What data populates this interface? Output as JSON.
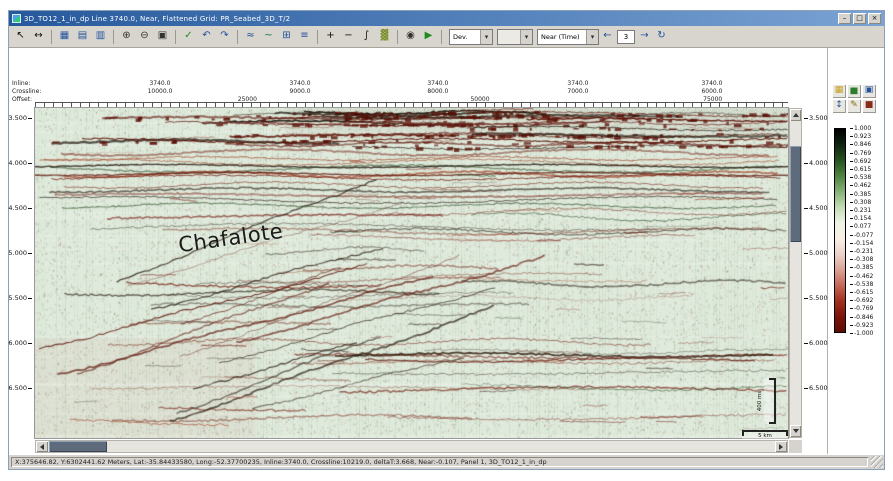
{
  "window": {
    "title": "3D_TO12_1_in_dp Line 3740.0, Near, Flattened Grid: PR_Seabed_3D_T/2",
    "buttons": [
      {
        "name": "minimize-button",
        "glyph": "–"
      },
      {
        "name": "maximize-button",
        "glyph": "□"
      },
      {
        "name": "close-button",
        "glyph": "×"
      }
    ]
  },
  "toolbar": {
    "icons": [
      {
        "name": "pointer-icon",
        "glyph": "↖",
        "color": "#111111"
      },
      {
        "name": "measure-icon",
        "glyph": "↔",
        "color": "#111111"
      },
      {
        "sep": true
      },
      {
        "name": "spreadsheet-icon",
        "glyph": "▦",
        "color": "#23519e"
      },
      {
        "name": "table-icon",
        "glyph": "▤",
        "color": "#23519e"
      },
      {
        "name": "histogram-icon",
        "glyph": "▥",
        "color": "#23519e"
      },
      {
        "sep": true
      },
      {
        "name": "zoom-in-icon",
        "glyph": "⊕",
        "color": "#333333"
      },
      {
        "name": "zoom-out-icon",
        "glyph": "⊖",
        "color": "#333333"
      },
      {
        "name": "zoom-window-icon",
        "glyph": "▣",
        "color": "#333333"
      },
      {
        "sep": true
      },
      {
        "name": "accept-icon",
        "glyph": "✓",
        "color": "#1f8a1f"
      },
      {
        "name": "undo-icon",
        "glyph": "↶",
        "color": "#23519e"
      },
      {
        "name": "redo-icon",
        "glyph": "↷",
        "color": "#23519e"
      },
      {
        "sep": true
      },
      {
        "name": "flatten-icon",
        "glyph": "≈",
        "color": "#23519e"
      },
      {
        "name": "horizon-icon",
        "glyph": "~",
        "color": "#0a7a3c"
      },
      {
        "name": "grid-icon",
        "glyph": "⊞",
        "color": "#23519e"
      },
      {
        "name": "layers-icon",
        "glyph": "≡",
        "color": "#23519e"
      },
      {
        "sep": true
      },
      {
        "name": "gain-up-icon",
        "glyph": "+",
        "color": "#111111"
      },
      {
        "name": "gain-down-icon",
        "glyph": "−",
        "color": "#111111"
      },
      {
        "name": "wiggle-trace-icon",
        "glyph": "∫",
        "color": "#111111"
      },
      {
        "name": "variable-density-icon",
        "glyph": "▓",
        "color": "#7a8f2a"
      },
      {
        "sep": true
      },
      {
        "name": "snapshot-icon",
        "glyph": "◉",
        "color": "#333333"
      },
      {
        "name": "play-icon",
        "glyph": "▶",
        "color": "#1f8a1f"
      },
      {
        "sep": true
      }
    ],
    "dev_dropdown_value": "Dev.",
    "disabled_dropdown_value": "",
    "mode_dropdown_value": "Near (Time)",
    "prev_icon": {
      "glyph": "←"
    },
    "next_icon": {
      "glyph": "→"
    },
    "refresh_icon": {
      "glyph": "↻"
    },
    "panel_value": "3"
  },
  "header": {
    "inline_label": "Inline:",
    "crossline_label": "Crossline:",
    "offset_label": "Offset:",
    "inline_ticks": [
      {
        "text": "3740.0",
        "pos": 16.6
      },
      {
        "text": "3740.0",
        "pos": 35.2
      },
      {
        "text": "3740.0",
        "pos": 53.5
      },
      {
        "text": "3740.0",
        "pos": 72.1
      },
      {
        "text": "3740.0",
        "pos": 89.9
      }
    ],
    "crossline_ticks": [
      {
        "text": "10000.0",
        "pos": 16.6
      },
      {
        "text": "9000.0",
        "pos": 35.2
      },
      {
        "text": "8000.0",
        "pos": 53.5
      },
      {
        "text": "7000.0",
        "pos": 72.1
      },
      {
        "text": "6000.0",
        "pos": 89.9
      }
    ],
    "offset_ticks": [
      {
        "text": "25000",
        "pos": 28.2
      },
      {
        "text": "50000",
        "pos": 59.1
      },
      {
        "text": "75000",
        "pos": 90.0
      }
    ]
  },
  "axes": {
    "times": [
      "3.500",
      "4.000",
      "4.500",
      "5.000",
      "5.500",
      "6.000",
      "6.500"
    ]
  },
  "annotation": {
    "text": "Chafalote"
  },
  "scalebar": {
    "vertical": "400 ms",
    "horizontal": "5 km"
  },
  "colorbar": {
    "values": [
      "1.000",
      "0.923",
      "0.846",
      "0.769",
      "0.692",
      "0.615",
      "0.538",
      "0.462",
      "0.385",
      "0.308",
      "0.231",
      "0.154",
      "0.077",
      "-0.077",
      "-0.154",
      "-0.231",
      "-0.308",
      "-0.385",
      "-0.462",
      "-0.538",
      "-0.615",
      "-0.692",
      "-0.769",
      "-0.846",
      "-0.923",
      "-1.000"
    ],
    "gradient": [
      "#000000",
      "#10240f",
      "#27521f",
      "#4d8440",
      "#86b277",
      "#c2dcb4",
      "#eef2e4",
      "#f7efe7",
      "#ecd3cb",
      "#dca396",
      "#c5685a",
      "#a3301f",
      "#7d140a",
      "#5e0d05"
    ]
  },
  "right_panel": {
    "icons": [
      {
        "name": "color-table-icon",
        "glyph": "▦",
        "color": "#c8a020"
      },
      {
        "name": "histogram-panel-icon",
        "glyph": "▅",
        "color": "#2d7d2d"
      },
      {
        "name": "save-palette-icon",
        "glyph": "▣",
        "color": "#23519e"
      },
      {
        "name": "flip-palette-icon",
        "glyph": "↕",
        "color": "#23519e"
      },
      {
        "name": "edit-palette-icon",
        "glyph": "✎",
        "color": "#8a6a10"
      },
      {
        "name": "lock-palette-icon",
        "glyph": "■",
        "color": "#8a2a1a"
      }
    ]
  },
  "statusbar": {
    "text": "X:375646.82, Y:6302441.62 Meters, Lat:-35.84433580, Long:-52.37700235,  Inline:3740.0, Crossline:10219.0, deltaT:3.668, Near:-0.107, Panel 1,  3D_TO12_1_in_dp"
  }
}
